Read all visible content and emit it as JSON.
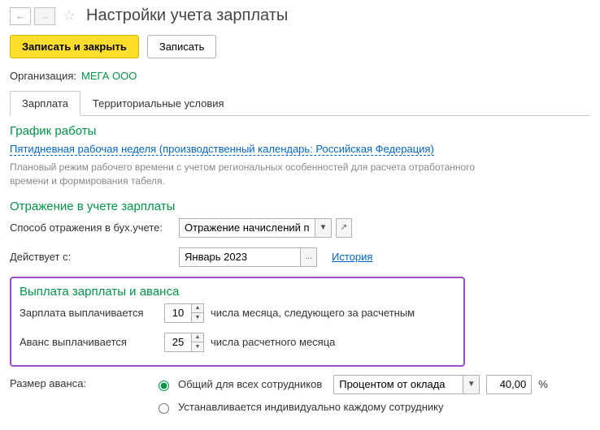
{
  "header": {
    "title": "Настройки учета зарплаты"
  },
  "toolbar": {
    "save_close": "Записать и закрыть",
    "save": "Записать"
  },
  "org": {
    "label": "Организация:",
    "value": "МЕГА ООО"
  },
  "tabs": {
    "salary": "Зарплата",
    "territorial": "Территориальные условия"
  },
  "schedule": {
    "title": "График работы",
    "link": "Пятидневная рабочая неделя (производственный календарь: Российская Федерация)",
    "help": "Плановый режим рабочего времени с учетом региональных особенностей для расчета отработанного времени и формирования табеля."
  },
  "accounting": {
    "title": "Отражение в учете зарплаты",
    "method_label": "Способ отражения в бух.учете:",
    "method_value": "Отражение начислений п",
    "effective_label": "Действует с:",
    "effective_value": "Январь 2023",
    "history": "История"
  },
  "payout": {
    "title": "Выплата зарплаты и аванса",
    "salary_label": "Зарплата выплачивается",
    "salary_day": "10",
    "salary_suffix": "числа месяца, следующего за расчетным",
    "advance_label": "Аванс выплачивается",
    "advance_day": "25",
    "advance_suffix": "числа расчетного месяца"
  },
  "advance_size": {
    "label": "Размер аванса:",
    "opt_common": "Общий для всех сотрудников",
    "opt_individual": "Устанавливается индивидуально каждому сотруднику",
    "percent_type": "Процентом от оклада",
    "percent_value": "40,00",
    "percent_sign": "%"
  }
}
